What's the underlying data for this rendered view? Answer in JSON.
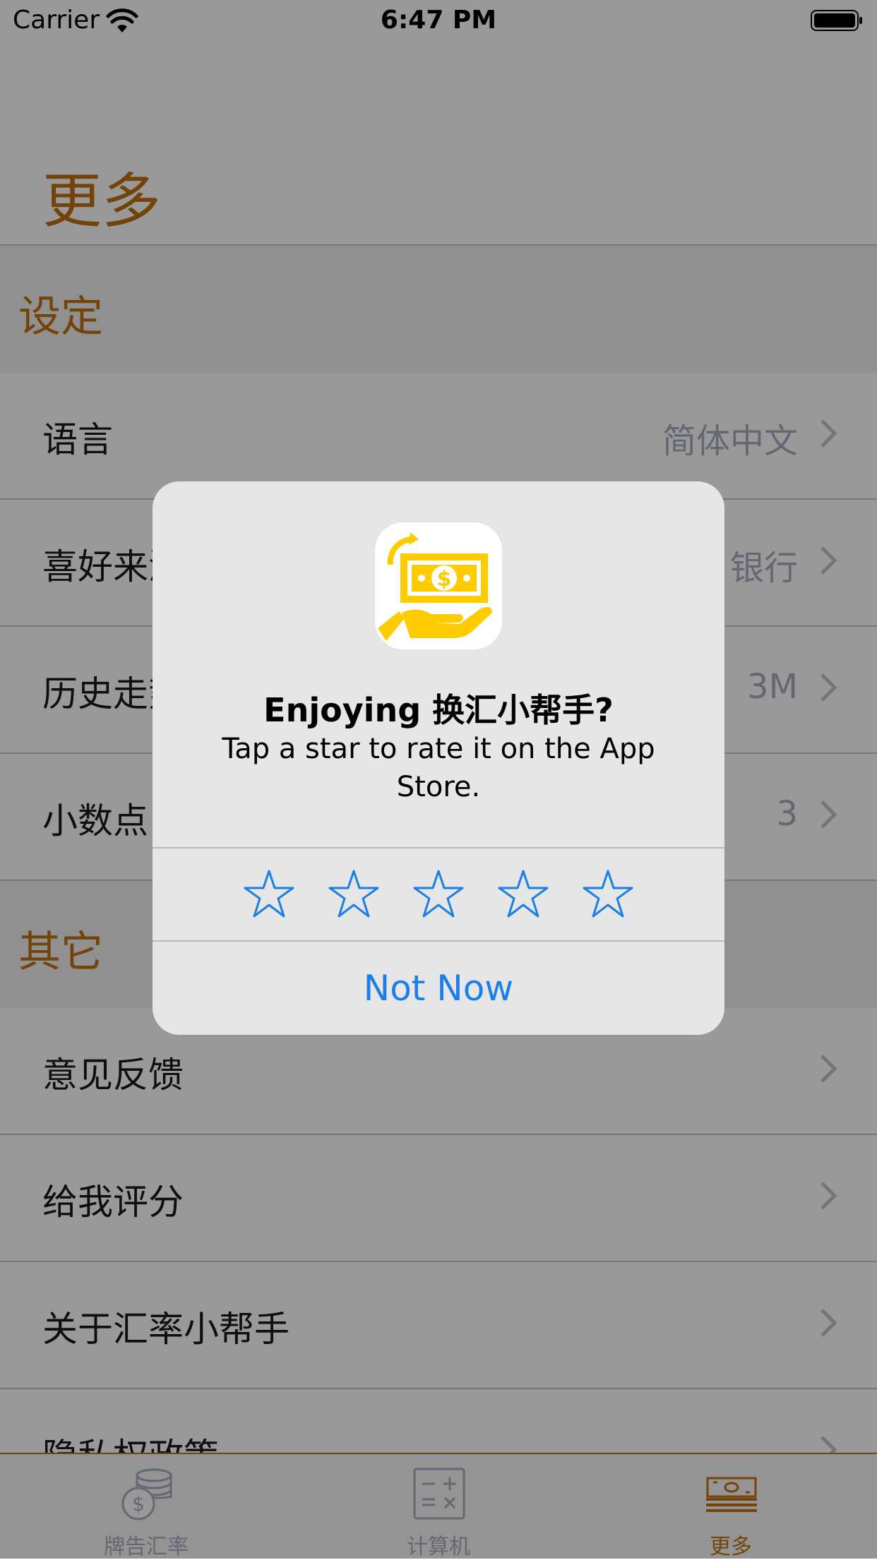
{
  "status_bar": {
    "carrier": "Carrier",
    "time": "6:47 PM"
  },
  "page_title": "更多",
  "sections": [
    {
      "header": "设定",
      "rows": [
        {
          "label": "语言",
          "value": "简体中文"
        },
        {
          "label": "喜好来源",
          "value": "银行"
        },
        {
          "label": "历史走势",
          "value": "3M"
        },
        {
          "label": "小数点",
          "value": "3"
        }
      ]
    },
    {
      "header": "其它",
      "rows": [
        {
          "label": "意见反馈",
          "value": ""
        },
        {
          "label": "给我评分",
          "value": ""
        },
        {
          "label": "关于汇率小帮手",
          "value": ""
        },
        {
          "label": "隐私权政策",
          "value": ""
        }
      ]
    }
  ],
  "alert": {
    "title": "Enjoying 换汇小帮手?",
    "message": "Tap a star to rate it on the App Store.",
    "star_count": 5,
    "dismiss_label": "Not Now"
  },
  "tab_bar": {
    "items": [
      {
        "label": "牌告汇率",
        "icon": "coins-dollar-icon",
        "active": false
      },
      {
        "label": "计算机",
        "icon": "calculator-icon",
        "active": false
      },
      {
        "label": "更多",
        "icon": "money-stack-icon",
        "active": true
      }
    ]
  },
  "colors": {
    "accent": "#c2700f",
    "link_blue": "#1a7fe8",
    "muted_value": "#a9acbf",
    "icon_yellow": "#ffcc00"
  }
}
